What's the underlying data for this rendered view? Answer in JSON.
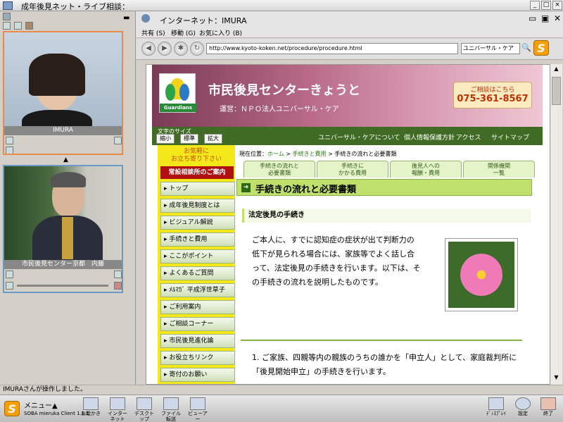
{
  "window": {
    "title": "成年後見ネット・ライブ相談："
  },
  "left_panel": {
    "video1_label": "IMURA",
    "video2_label": "市民後見センター京都　内藤"
  },
  "browser": {
    "title": "インターネット：IMURA",
    "menu": [
      "共有 (S)",
      "移動 (G)",
      "お気に入り (B)"
    ],
    "url": "http://www.kyoto-koken.net/procedure/procedure.html",
    "search_value": "ユニバーサル・ケア",
    "site": {
      "title": "市民後見センターきょうと",
      "subtitle": "運営：ＮＰＯ法人ユニバーサル・ケア",
      "logo_text": "Guardians",
      "consult_label": "ご相談はこちら",
      "phone": "075-361-8567",
      "font_size_label": "文字のサイズ",
      "font_sizes": [
        "縮小",
        "標準",
        "拡大"
      ],
      "global_nav": [
        "ユニバーサル・ケアについて",
        "個人情報保護方針",
        "アクセス",
        "サイトマップ"
      ],
      "sidebar_top": "お気軽に\nお立ち寄り下さい",
      "consult_office": "常設相談所のご案内",
      "menu": [
        "トップ",
        "成年後見制度とは",
        "ビジュアル解説",
        "手続きと費用",
        "ここがポイント",
        "よくあるご質問",
        "ﾒﾙﾏｶﾞ 平成浮世草子",
        "ご利用案内",
        "ご相談コーナー",
        "市民後見進化論",
        "お役立ちリンク",
        "寄付のお願い"
      ],
      "breadcrumb": {
        "prefix": "現在位置：",
        "home": "ホーム",
        "sep": " > ",
        "level2": "手続きと費用",
        "current": "手続きの流れと必要書類"
      },
      "tabs": [
        "手続きの流れと\n必要書類",
        "手続きに\nかかる費用",
        "後見人への\n報酬・費用",
        "関係機関\n一覧"
      ],
      "page_title": "手続きの流れと必要書類",
      "section_title": "法定後見の手続き",
      "paragraph": "ご本人に、すでに認知症の症状が出て判断力の低下が見られる場合には、家族等でよく話し合って、法定後見の手続きを行います。以下は、その手続きの流れを説明したものです。",
      "step1": "1. ご家族、四親等内の親族のうちの誰かを「申立人」として、家庭裁判所に「後見開始申立」の手続きを行います。"
    }
  },
  "status": "IMURAさんが操作しました。",
  "taskbar": {
    "menu_label": "メニュー▲",
    "client_label": "SOBA mieruka Client 1.1.1",
    "apps": [
      "お絵かき",
      "インターネット",
      "デスクトップ",
      "ファイル転送",
      "ビューアー"
    ],
    "right": [
      "ﾃﾞｨｽﾌﾟﾚｲ",
      "設定",
      "終了"
    ]
  }
}
